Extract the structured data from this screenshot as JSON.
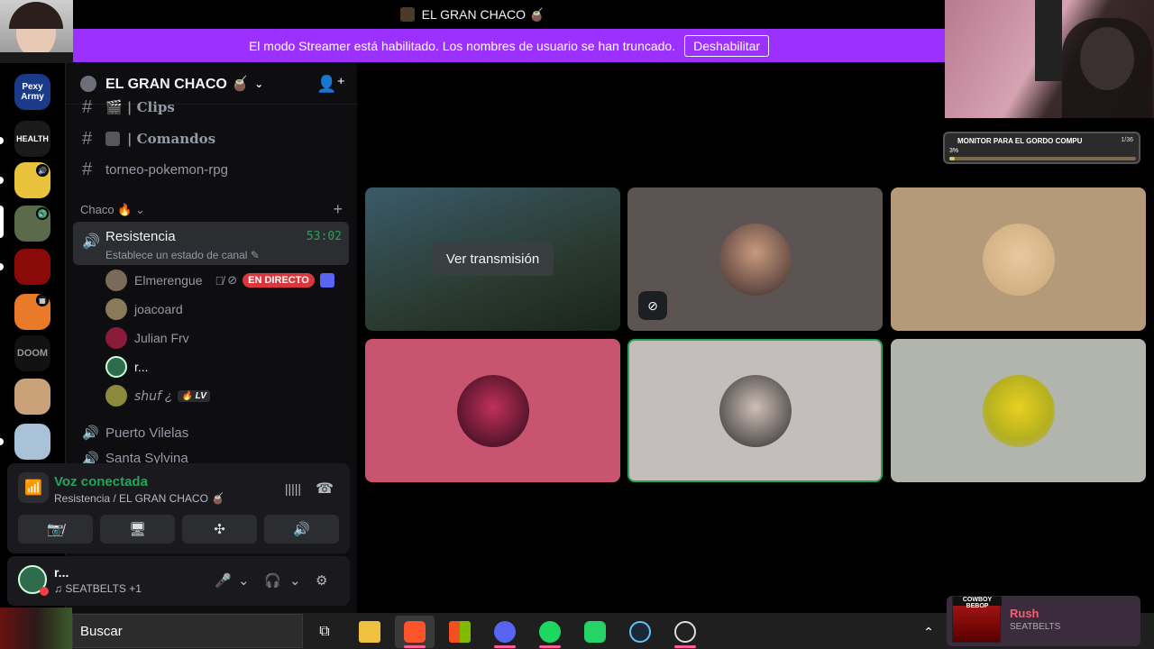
{
  "window": {
    "title": "EL GRAN CHACO 🧉"
  },
  "streamer_banner": {
    "text": "El modo Streamer está habilitado. Los nombres de usuario se han truncado.",
    "button": "Deshabilitar"
  },
  "rail": {
    "items": [
      {
        "label": "Pexy Army",
        "color": "#1c3a8a"
      },
      {
        "label": "HEALTH",
        "color": "#1a1a1a"
      },
      {
        "label": "",
        "color": "#e8c23a"
      },
      {
        "label": "",
        "color": "#5a6a4a"
      },
      {
        "label": "",
        "color": "#8a0a0a"
      },
      {
        "label": "",
        "color": "#e87a2a"
      },
      {
        "label": "DOOM",
        "color": "#111111"
      },
      {
        "label": "",
        "color": "#c9a27a"
      },
      {
        "label": "",
        "color": "#a9c2d8"
      }
    ]
  },
  "server": {
    "name": "EL GRAN CHACO 🧉"
  },
  "channels": [
    {
      "name": "🎬 | Clips"
    },
    {
      "name": "| Comandos"
    },
    {
      "name": "torneo-pokemon-rpg"
    }
  ],
  "category": {
    "name": "Chaco 🔥"
  },
  "active_voice": {
    "name": "Resistencia",
    "status": "Establece un estado de canal",
    "timer": "53:02"
  },
  "voice_users": [
    {
      "name": "Elmerengue",
      "live": "EN DIRECTO",
      "color": "#7a6a5a"
    },
    {
      "name": "joacoard",
      "color": "#8a7a5a"
    },
    {
      "name": "Julian Frv",
      "color": "#8a1a3a"
    },
    {
      "name": "r...",
      "color": "#2f6b4d"
    },
    {
      "name": "𝘴𝘩𝘶𝘧 ¿",
      "badge": "LV",
      "color": "#8a8a3a"
    }
  ],
  "other_voice": [
    {
      "name": "Puerto Vilelas"
    },
    {
      "name": "Santa Sylvina"
    }
  ],
  "voice_panel": {
    "title": "Voz conectada",
    "sub": "Resistencia / EL GRAN CHACO 🧉"
  },
  "user_panel": {
    "name": "r...",
    "activity": "♫ SEATBELTS +1"
  },
  "stage": {
    "watch": "Ver transmisión"
  },
  "monitor": {
    "title": "MONITOR PARA EL GORDO COMPU",
    "count": "1/36",
    "percent": "3%",
    "progress": 0.03
  },
  "taskbar": {
    "search": "Buscar"
  },
  "media": {
    "art_label": "COWBOY BEBOP",
    "title": "Rush",
    "artist": "SEATBELTS"
  }
}
